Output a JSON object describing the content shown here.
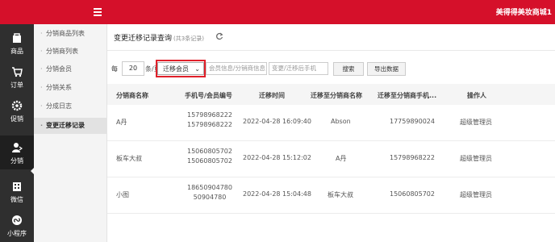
{
  "header": {
    "brand": "美得得美妆商城1"
  },
  "leftnav": {
    "items": [
      {
        "label": "商品",
        "icon": "bag-icon"
      },
      {
        "label": "订单",
        "icon": "cart-icon"
      },
      {
        "label": "促销",
        "icon": "gear-icon"
      },
      {
        "label": "分销",
        "icon": "user-share-icon",
        "active": true
      },
      {
        "label": "微信",
        "icon": "building-icon"
      },
      {
        "label": "小程序",
        "icon": "miniprogram-icon"
      }
    ]
  },
  "subnav": {
    "items": [
      {
        "label": "分销商品列表"
      },
      {
        "label": "分销商列表"
      },
      {
        "label": "分销会员"
      },
      {
        "label": "分销关系"
      },
      {
        "label": "分成日志"
      },
      {
        "label": "变更迁移记录",
        "active": true
      }
    ]
  },
  "main": {
    "title": "变更迁移记录查询",
    "count": "(共3条记录)",
    "filter": {
      "per_label": "每",
      "per_value": "20",
      "per_unit": "条/页",
      "select_value": "迁移会员",
      "search1_placeholder": "会员信息/分销商信息",
      "search2_placeholder": "变更/迁移后手机",
      "search_button": "搜索",
      "export_button": "导出数据"
    },
    "table": {
      "headers": [
        "分销商名称",
        "手机号/会员编号",
        "迁移时间",
        "迁移至分销商名称",
        "迁移至分销商手机...",
        "操作人"
      ],
      "rows": [
        {
          "name": "A丹",
          "phone1": "15798968222",
          "phone2": "15798968222",
          "time": "2022-04-28 16:09:40",
          "to_name": "Abson",
          "to_phone": "17759890024",
          "operator": "超级管理员"
        },
        {
          "name": "板车大叔",
          "phone1": "15060805702",
          "phone2": "15060805702",
          "time": "2022-04-28 15:12:02",
          "to_name": "A丹",
          "to_phone": "15798968222",
          "operator": "超级管理员"
        },
        {
          "name": "小图",
          "phone1": "18650904780",
          "phone2": "50904780",
          "time": "2022-04-28 15:04:48",
          "to_name": "板车大叔",
          "to_phone": "15060805702",
          "operator": "超级管理员"
        }
      ]
    }
  },
  "colors": {
    "brand_red": "#d5102a",
    "sidebar_dark": "#2f2f2f",
    "highlight_red": "#e0202a"
  }
}
